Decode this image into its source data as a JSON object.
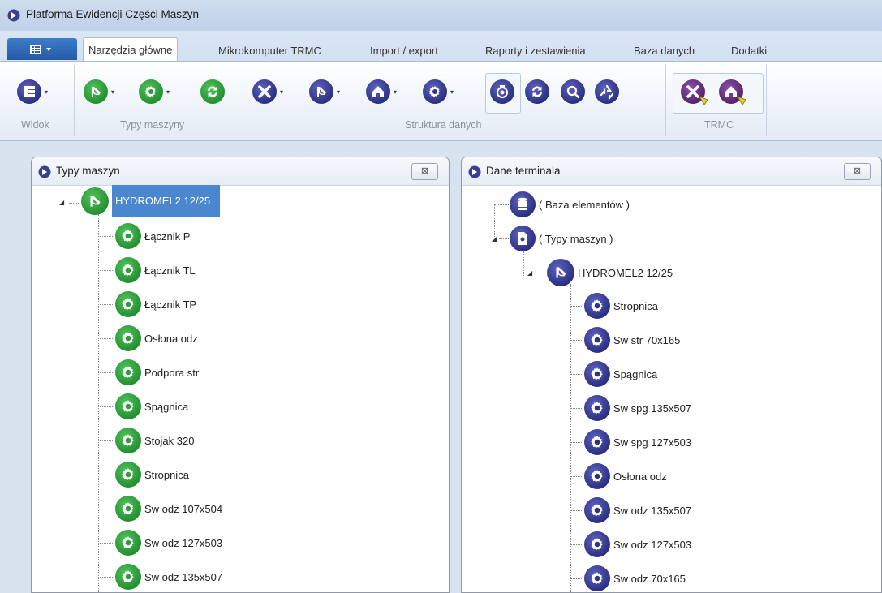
{
  "window": {
    "title": "Platforma Ewidencji Części Maszyn"
  },
  "ribbon": {
    "tabs": [
      {
        "label": "Narzędzia główne"
      },
      {
        "label": "Mikrokomputer TRMC"
      },
      {
        "label": "Import / export"
      },
      {
        "label": "Raporty i zestawienia"
      },
      {
        "label": "Baza danych"
      },
      {
        "label": "Dodatki"
      }
    ],
    "groups": {
      "widok": "Widok",
      "typy": "Typy maszyny",
      "struktura": "Struktura danych",
      "trmc": "TRMC"
    }
  },
  "left_panel": {
    "title": "Typy maszyn",
    "root": "HYDROMEL2 12/25",
    "children": [
      "Łącznik P",
      "Łącznik TL",
      "Łącznik TP",
      "Osłona odz",
      "Podpora str",
      "Spągnica",
      "Stojak 320",
      "Stropnica",
      "Sw odz 107x504",
      "Sw odz 127x503",
      "Sw odz 135x507"
    ]
  },
  "right_panel": {
    "title": "Dane terminala",
    "db": "( Baza elementów )",
    "types": "( Typy maszyn )",
    "root": "HYDROMEL2 12/25",
    "children": [
      "Stropnica",
      "Sw str 70x165",
      "Spągnica",
      "Sw spg 135x507",
      "Sw spg 127x503",
      "Osłona odz",
      "Sw odz 135x507",
      "Sw odz 127x503",
      "Sw odz 70x165"
    ]
  },
  "colors": {
    "accent": "#4a87cf",
    "green": "#2e9a3b",
    "purple": "#3b3f8f"
  }
}
